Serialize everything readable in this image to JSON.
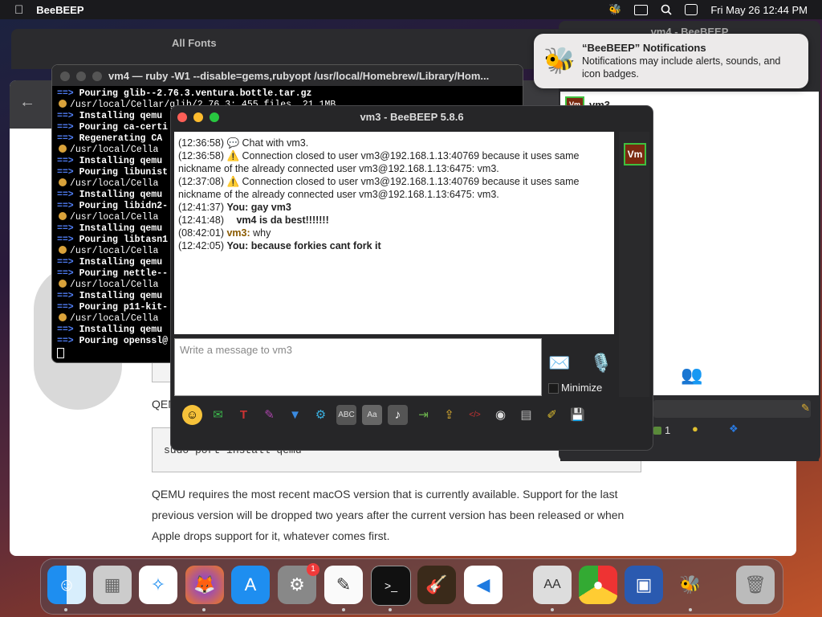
{
  "menubar": {
    "app_name": "BeeBEEP",
    "date_time": "Fri May 26  12:44 PM"
  },
  "fonts_window": {
    "title": "All Fonts"
  },
  "beebeep_main": {
    "title": "vm4 - BeeBEEP",
    "user": "vm3",
    "bottom_count": "1"
  },
  "terminal": {
    "title": "vm4 — ruby -W1 --disable=gems,rubyopt /usr/local/Homebrew/Library/Hom...",
    "lines": [
      {
        "kind": "arrow",
        "text": "Pouring glib--2.76.3.ventura.bottle.tar.gz"
      },
      {
        "kind": "beer",
        "text": "/usr/local/Cellar/glib/2.76.3: 455 files, 21.1MB"
      },
      {
        "kind": "arrow",
        "text": "Installing qemu"
      },
      {
        "kind": "arrow",
        "text": "Pouring ca-certi"
      },
      {
        "kind": "arrow",
        "text": "Regenerating CA"
      },
      {
        "kind": "beer",
        "text": "/usr/local/Cella"
      },
      {
        "kind": "arrow",
        "text": "Installing qemu"
      },
      {
        "kind": "arrow",
        "text": "Pouring libunist"
      },
      {
        "kind": "beer",
        "text": "/usr/local/Cella"
      },
      {
        "kind": "arrow",
        "text": "Installing qemu"
      },
      {
        "kind": "arrow",
        "text": "Pouring libidn2-"
      },
      {
        "kind": "beer",
        "text": "/usr/local/Cella"
      },
      {
        "kind": "arrow",
        "text": "Installing qemu"
      },
      {
        "kind": "arrow",
        "text": "Pouring libtasn1"
      },
      {
        "kind": "beer",
        "text": "/usr/local/Cella"
      },
      {
        "kind": "arrow",
        "text": "Installing qemu"
      },
      {
        "kind": "arrow",
        "text": "Pouring nettle--"
      },
      {
        "kind": "beer",
        "text": "/usr/local/Cella"
      },
      {
        "kind": "arrow",
        "text": "Installing qemu"
      },
      {
        "kind": "arrow",
        "text": "Pouring p11-kit-"
      },
      {
        "kind": "beer",
        "text": "/usr/local/Cella"
      },
      {
        "kind": "arrow",
        "text": "Installing qemu"
      },
      {
        "kind": "arrow",
        "text": "Pouring openssl@"
      }
    ]
  },
  "notification": {
    "title": "“BeeBEEP” Notifications",
    "body": "Notifications may include alerts, sounds, and icon badges."
  },
  "chat": {
    "title": "vm3 - BeeBEEP 5.8.6",
    "messages": [
      {
        "time": "(12:36:58)",
        "icon": "chat-bubble-icon",
        "sender": "",
        "text": "Chat with vm3."
      },
      {
        "time": "(12:36:58)",
        "icon": "warning-icon",
        "sender": "",
        "text": "Connection closed to user vm3@192.168.1.13:40769 because it uses same nickname of the already connected user vm3@192.168.1.13:6475: vm3."
      },
      {
        "time": "(12:37:08)",
        "icon": "warning-icon",
        "sender": "",
        "text": "Connection closed to user vm3@192.168.1.13:40769 because it uses same nickname of the already connected user vm3@192.168.1.13:6475: vm3."
      },
      {
        "time": "(12:41:37)",
        "icon": "",
        "sender": "You:",
        "text": "gay vm3"
      },
      {
        "time": "(12:41:48)",
        "icon": "",
        "sender": "",
        "text": "vm4 is da best!!!!!!!"
      },
      {
        "time": "(08:42:01)",
        "icon": "",
        "sender": "vm3:",
        "text": "why"
      },
      {
        "time": "(12:42:05)",
        "icon": "",
        "sender": "You:",
        "text": "because forkies cant fork it"
      }
    ],
    "input_placeholder": "Write a message to vm3",
    "minimize_label": "Minimize",
    "avatar_label": "Vm"
  },
  "browser": {
    "code1": "sudo port install qemu",
    "qemu_prefix": "QEM",
    "paragraph": "QEMU requires the most recent macOS version that is currently available. Support for the last previous version will be dropped two years after the current version has been released or when Apple drops support for it, whatever comes first."
  },
  "dock": {
    "settings_badge": "1",
    "items": [
      "finder-icon",
      "launchpad-icon",
      "safari-icon",
      "firefox-icon",
      "app-store-icon",
      "system-settings-icon",
      "textedit-icon",
      "terminal-icon",
      "garageband-icon",
      "vscode-icon",
      "font-book-icon",
      "chrome-icon",
      "virtualbox-icon",
      "beebeep-icon",
      "trash-icon"
    ]
  }
}
